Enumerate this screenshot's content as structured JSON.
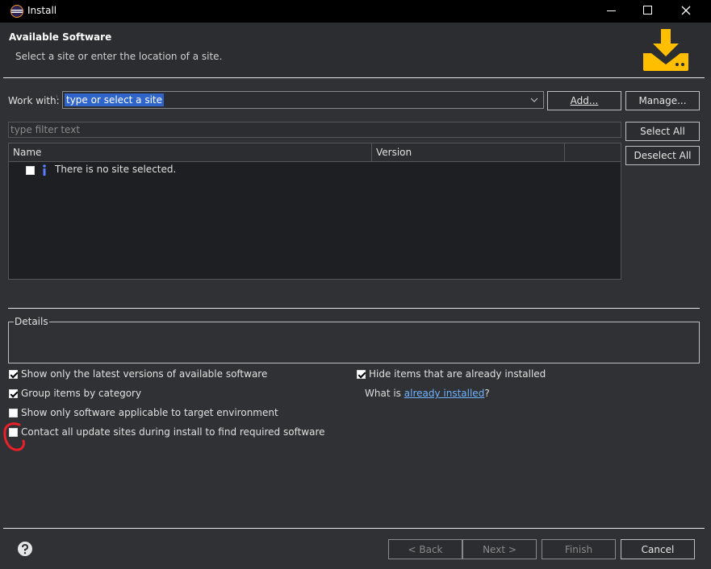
{
  "window": {
    "title": "Install"
  },
  "header": {
    "title": "Available Software",
    "subtitle": "Select a site or enter the location of a site."
  },
  "work_with": {
    "label": "Work with:",
    "value": "type or select a site",
    "add_label": "Add...",
    "manage_label": "Manage..."
  },
  "filter": {
    "placeholder": "type filter text"
  },
  "buttons": {
    "select_all": "Select All",
    "deselect_all": "Deselect All"
  },
  "table": {
    "columns": [
      "Name",
      "Version"
    ],
    "empty_message": "There is no site selected."
  },
  "details": {
    "label": "Details"
  },
  "options": {
    "latest_versions": {
      "label": "Show only the latest versions of available software",
      "checked": true
    },
    "group_by_category": {
      "label": "Group items by category",
      "checked": true
    },
    "target_environment": {
      "label": "Show only software applicable to target environment",
      "checked": false
    },
    "contact_all_sites": {
      "label": "Contact all update sites during install to find required software",
      "checked": false
    },
    "hide_installed": {
      "label": "Hide items that are already installed",
      "checked": true
    },
    "what_is_prefix": "What is",
    "what_is_link": "already installed",
    "what_is_suffix": "?"
  },
  "footer": {
    "back": "< Back",
    "next": "Next >",
    "finish": "Finish",
    "cancel": "Cancel"
  },
  "colors": {
    "accent": "#ffbf00",
    "link": "#6fb3ff",
    "selection": "#2f65ca",
    "annotation": "#e8202a"
  }
}
